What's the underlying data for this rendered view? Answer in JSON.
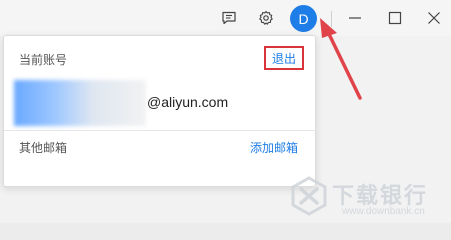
{
  "titlebar": {
    "avatar_initial": "D",
    "icons": [
      "feedback-icon",
      "settings-icon",
      "minimize-icon",
      "maximize-icon",
      "close-icon"
    ]
  },
  "account_popup": {
    "current_account_label": "当前账号",
    "logout_label": "退出",
    "account_email": "@aliyun.com",
    "other_mailbox_label": "其他邮箱",
    "add_mailbox_label": "添加邮箱"
  },
  "watermark": {
    "name": "下载银行",
    "url": "www.downbank.cn"
  },
  "colors": {
    "accent": "#1e7de6",
    "highlight": "#d8343a",
    "watermark": "#cfd4da"
  }
}
